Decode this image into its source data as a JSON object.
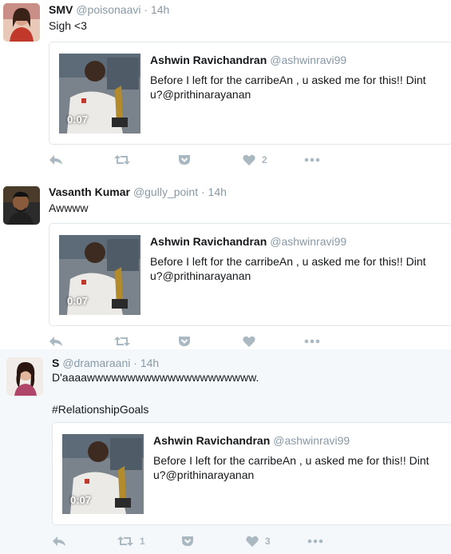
{
  "tweets": [
    {
      "name": "SMV",
      "handle": "@poisonaavi",
      "dot": "·",
      "time": "14h",
      "text": "Sigh <3",
      "avatar_icon": "user-avatar-woman",
      "quote": {
        "name": "Ashwin Ravichandran",
        "handle": "@ashwinravi99",
        "text": "Before I left for the carribeAn , u asked me for this!! Dint u?@prithinarayanan",
        "duration": "0:07"
      },
      "actions": {
        "reply_icon": "reply-icon",
        "retweet_icon": "retweet-icon",
        "retweets": "",
        "pocket_icon": "pocket-icon",
        "like_icon": "heart-icon",
        "likes": "2",
        "more_icon": "more-icon"
      }
    },
    {
      "name": "Vasanth Kumar",
      "handle": "@gully_point",
      "dot": "·",
      "time": "14h",
      "text": "Awwww",
      "avatar_icon": "user-avatar-man",
      "quote": {
        "name": "Ashwin Ravichandran",
        "handle": "@ashwinravi99",
        "text": "Before I left for the carribeAn , u asked me for this!! Dint u?@prithinarayanan",
        "duration": "0:07"
      },
      "actions": {
        "reply_icon": "reply-icon",
        "retweet_icon": "retweet-icon",
        "retweets": "",
        "pocket_icon": "pocket-icon",
        "like_icon": "heart-icon",
        "likes": "",
        "more_icon": "more-icon"
      }
    },
    {
      "name": "S",
      "handle": "@dramaraani",
      "dot": "·",
      "time": "14h",
      "text": "D'aaaawwwwwwwwwwwwwwwwwwwww.\n\n#RelationshipGoals",
      "avatar_icon": "user-avatar-woman",
      "quote": {
        "name": "Ashwin Ravichandran",
        "handle": "@ashwinravi99",
        "text": "Before I left for the carribeAn , u asked me for this!! Dint u?@prithinarayanan",
        "duration": "0:07"
      },
      "actions": {
        "reply_icon": "reply-icon",
        "retweet_icon": "retweet-icon",
        "retweets": "1",
        "pocket_icon": "pocket-icon",
        "like_icon": "heart-icon",
        "likes": "3",
        "more_icon": "more-icon"
      }
    }
  ],
  "colors": {
    "muted": "#8899a6",
    "icon": "#aab8c2",
    "border": "#e1e8ed",
    "highlight_bg": "#f5f8fa"
  }
}
